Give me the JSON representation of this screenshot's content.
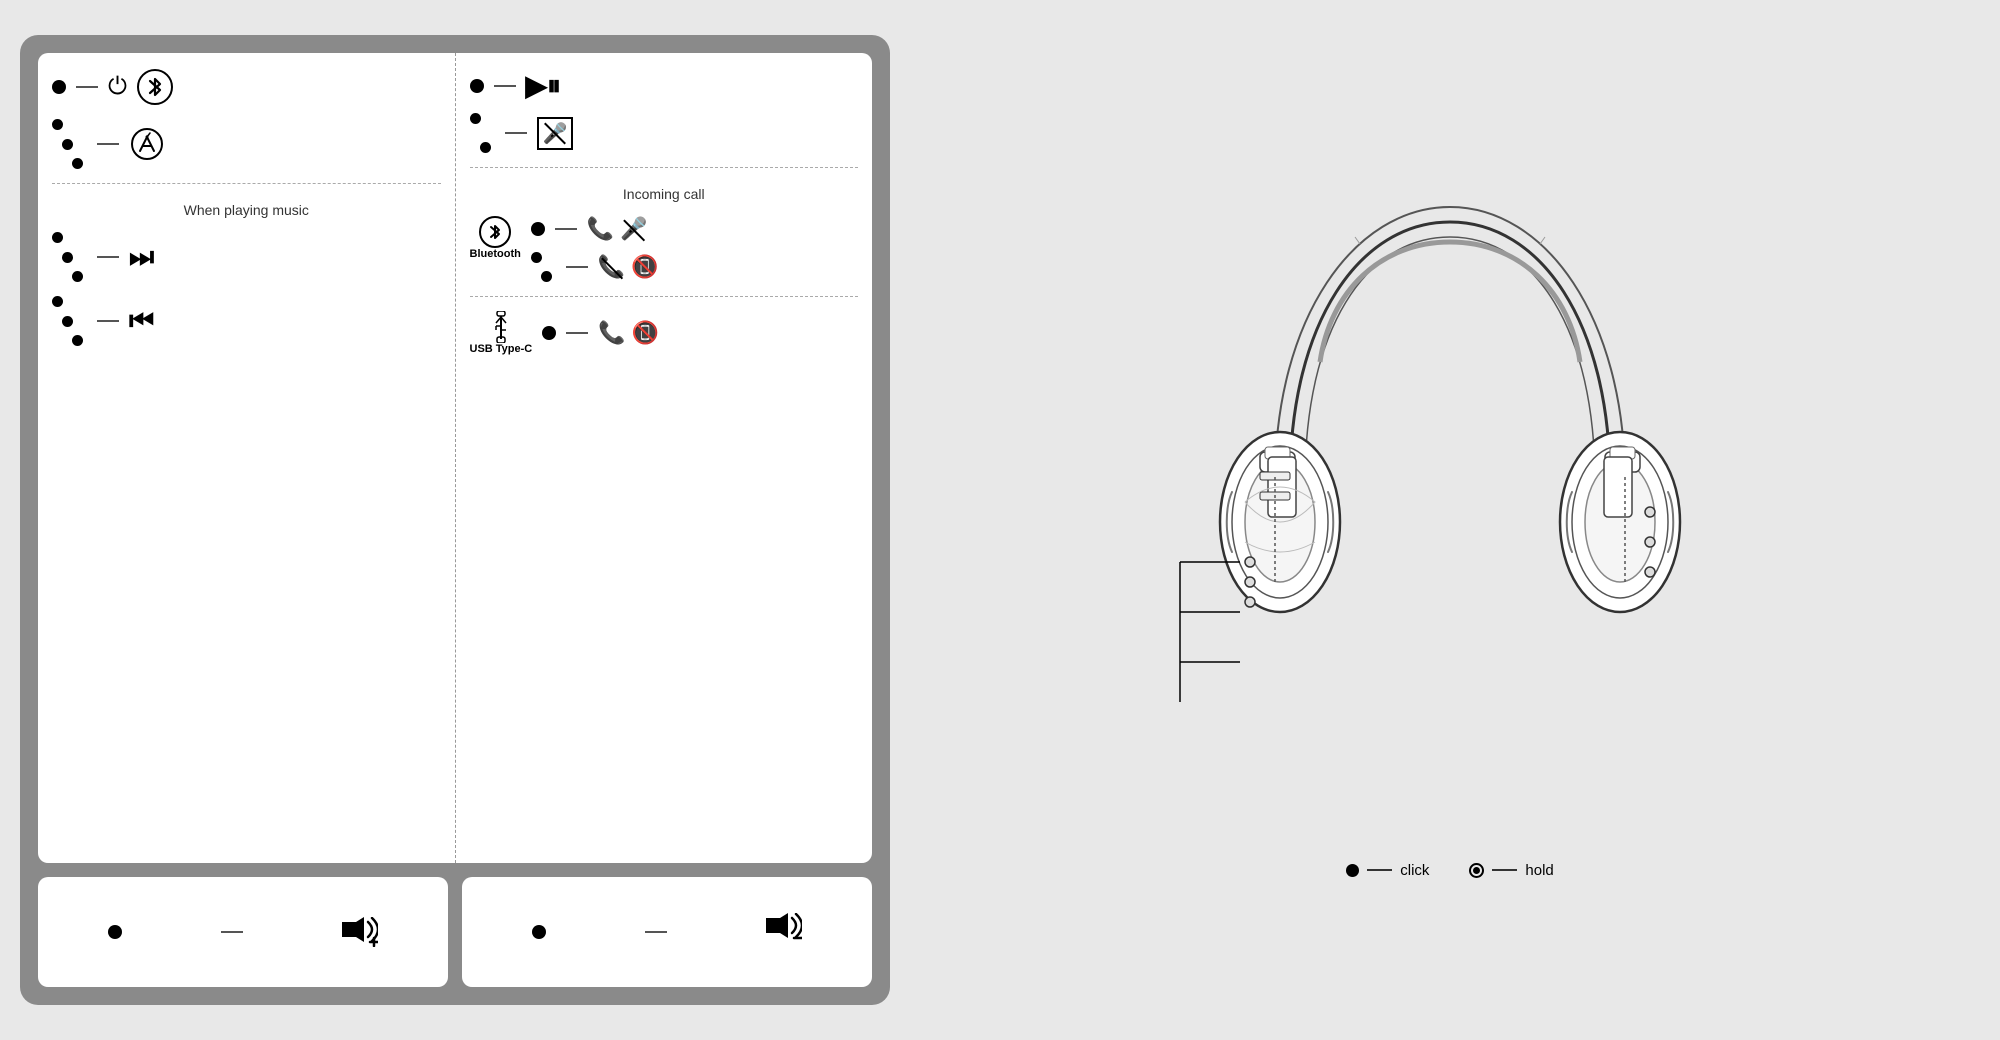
{
  "panel": {
    "left": {
      "row1": {
        "type": "single_click",
        "icons": [
          "power",
          "bluetooth"
        ]
      },
      "row2": {
        "type": "hold",
        "icons": [
          "athos"
        ]
      },
      "divider": true,
      "section_title": "When playing music",
      "row3": {
        "type": "hold",
        "icons": [
          "skip_next"
        ]
      },
      "row4": {
        "type": "hold",
        "icons": [
          "skip_prev"
        ]
      }
    },
    "right": {
      "row1": {
        "type": "single_click",
        "icons": [
          "play_pause"
        ]
      },
      "row2": {
        "type": "hold",
        "icons": [
          "mute_mic"
        ]
      },
      "divider": true,
      "section_title": "Incoming call",
      "bluetooth_section": {
        "label": "Bluetooth",
        "row1": {
          "type": "single_click",
          "icons": [
            "answer_mute"
          ]
        },
        "row2": {
          "type": "hold",
          "icons": [
            "reject"
          ]
        }
      },
      "usb_section": {
        "label": "USB Type-C",
        "row1": {
          "type": "single_click",
          "icons": [
            "answer"
          ]
        }
      }
    }
  },
  "bottom": {
    "vol_up": {
      "label": "🔊+"
    },
    "vol_down": {
      "label": "🔊-"
    }
  },
  "legend": {
    "click_label": "click",
    "hold_label": "hold"
  },
  "section_titles": {
    "when_playing_music": "When playing music",
    "incoming_call": "Incoming call"
  },
  "connection_labels": {
    "bluetooth": "Bluetooth",
    "usb": "USB Type-C"
  },
  "volume_plus": "◄+",
  "volume_minus": "◄-"
}
